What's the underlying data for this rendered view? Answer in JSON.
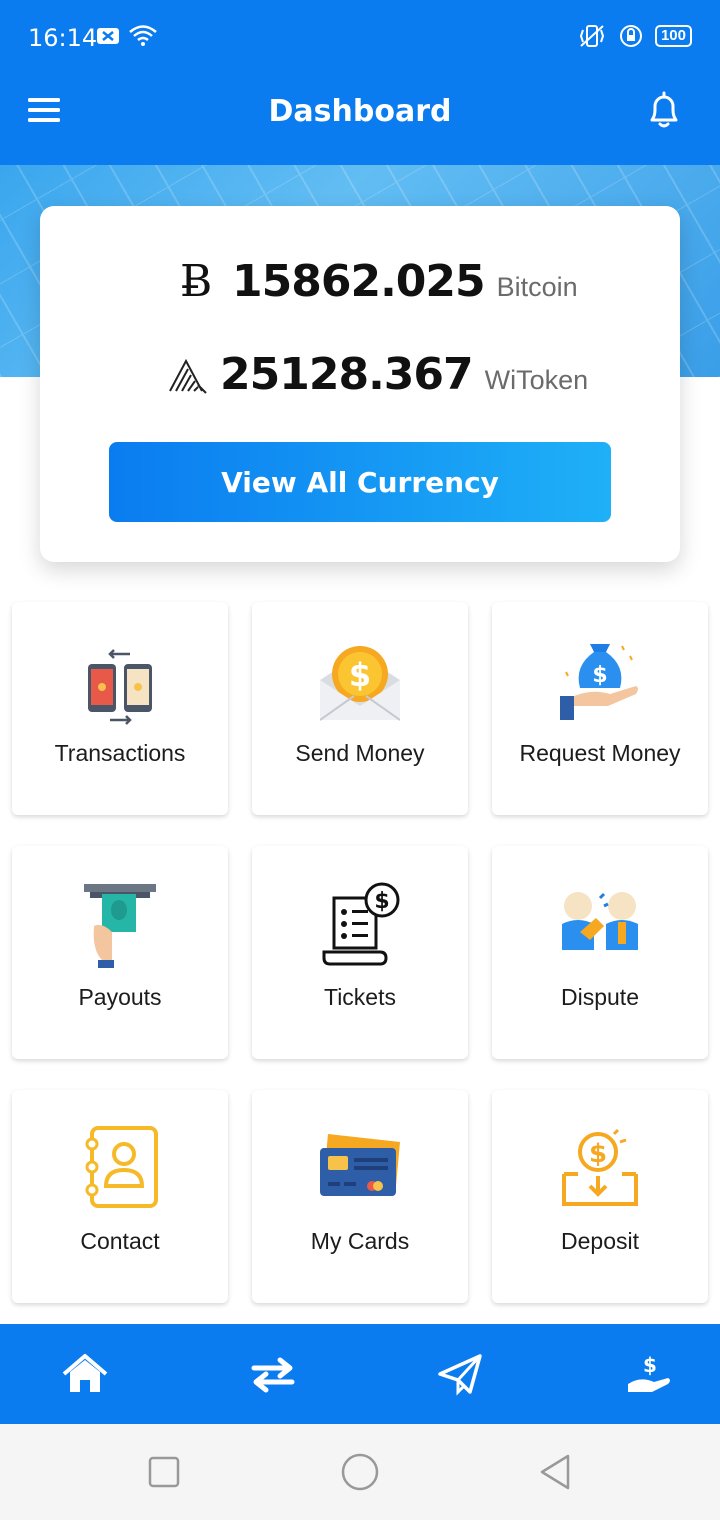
{
  "status_bar": {
    "time": "16:14",
    "battery": "100"
  },
  "app_bar": {
    "title": "Dashboard"
  },
  "balances": [
    {
      "value": "15862.025",
      "unit": "Bitcoin",
      "icon": "bitcoin-b-icon"
    },
    {
      "value": "25128.367",
      "unit": "WiToken",
      "icon": "witoken-icon"
    }
  ],
  "view_all_label": "View All Currency",
  "tiles": [
    {
      "label": "Transactions",
      "icon": "transactions-icon"
    },
    {
      "label": "Send Money",
      "icon": "send-money-icon"
    },
    {
      "label": "Request Money",
      "icon": "request-money-icon"
    },
    {
      "label": "Payouts",
      "icon": "payouts-icon"
    },
    {
      "label": "Tickets",
      "icon": "tickets-icon"
    },
    {
      "label": "Dispute",
      "icon": "dispute-icon"
    },
    {
      "label": "Contact",
      "icon": "contact-icon"
    },
    {
      "label": "My Cards",
      "icon": "my-cards-icon"
    },
    {
      "label": "Deposit",
      "icon": "deposit-icon"
    }
  ],
  "bottom_nav": [
    "home-icon",
    "transfer-icon",
    "send-icon",
    "request-icon"
  ],
  "colors": {
    "primary": "#0a7cf0",
    "gradient_end": "#1fb0f7",
    "card_bg": "#ffffff"
  }
}
